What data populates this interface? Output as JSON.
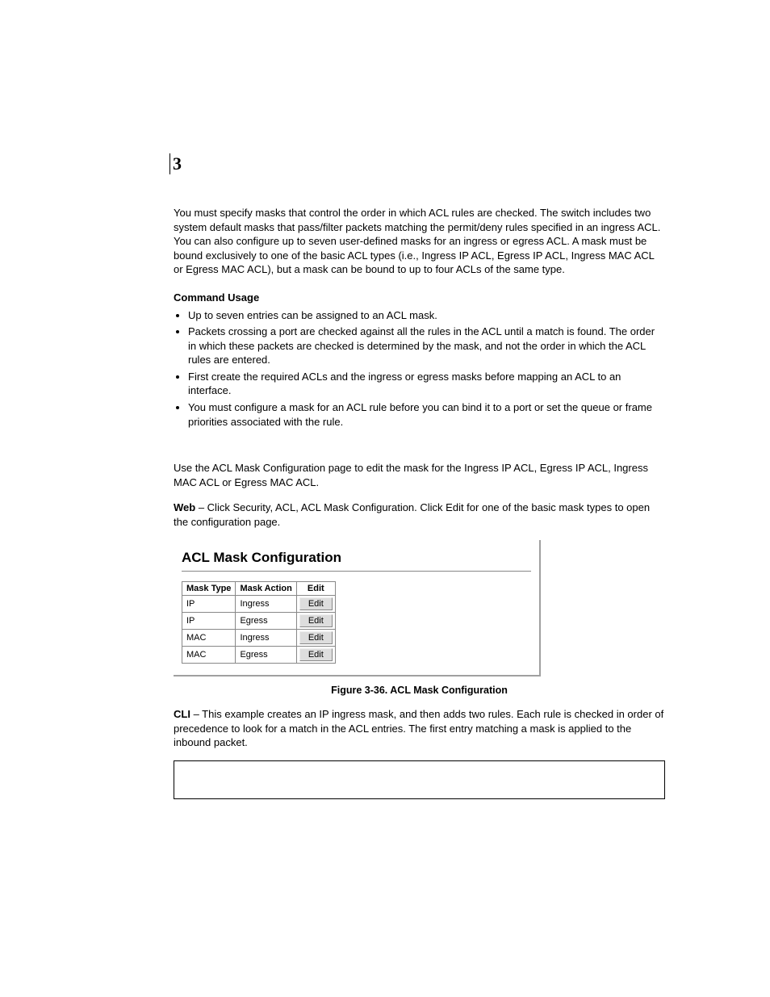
{
  "page_badge": "3",
  "intro": "You must specify masks that control the order in which ACL rules are checked. The switch includes two system default masks that pass/filter packets matching the permit/deny rules specified in an ingress ACL. You can also configure up to seven user-defined masks for an ingress or egress ACL. A mask must be bound exclusively to one of the basic ACL types (i.e., Ingress IP ACL, Egress IP ACL, Ingress MAC ACL or Egress MAC ACL), but a mask can be bound to up to four ACLs of the same type.",
  "cmd_usage_title": "Command Usage",
  "bullets": [
    "Up to seven entries can be assigned to an ACL mask.",
    "Packets crossing a port are checked against all the rules in the ACL until a match is found. The order in which these packets are checked is determined by the mask, and not the order in which the ACL rules are entered.",
    "First create the required ACLs and the ingress or egress masks before mapping an ACL to an interface.",
    "You must configure a mask for an ACL rule before you can bind it to a port or set the queue or frame priorities associated with the rule."
  ],
  "section_para": "Use the ACL Mask Configuration page to edit the mask for the Ingress IP ACL, Egress IP ACL, Ingress MAC ACL or Egress MAC ACL.",
  "web_label": "Web",
  "web_rest": " – Click Security, ACL, ACL Mask Configuration. Click Edit for one of the basic mask types to open the configuration page.",
  "screenshot_title": "ACL Mask Configuration",
  "table": {
    "headers": [
      "Mask Type",
      "Mask Action",
      "Edit"
    ],
    "rows": [
      {
        "type": "IP",
        "action": "Ingress",
        "btn": "Edit"
      },
      {
        "type": "IP",
        "action": "Egress",
        "btn": "Edit"
      },
      {
        "type": "MAC",
        "action": "Ingress",
        "btn": "Edit"
      },
      {
        "type": "MAC",
        "action": "Egress",
        "btn": "Edit"
      }
    ]
  },
  "figure_caption": "Figure 3-36.  ACL Mask Configuration",
  "cli_label": "CLI",
  "cli_rest": " – This example creates an IP ingress mask, and then adds two rules. Each rule is checked in order of precedence to look for a match in the ACL entries. The first entry matching a mask is applied to the inbound packet."
}
